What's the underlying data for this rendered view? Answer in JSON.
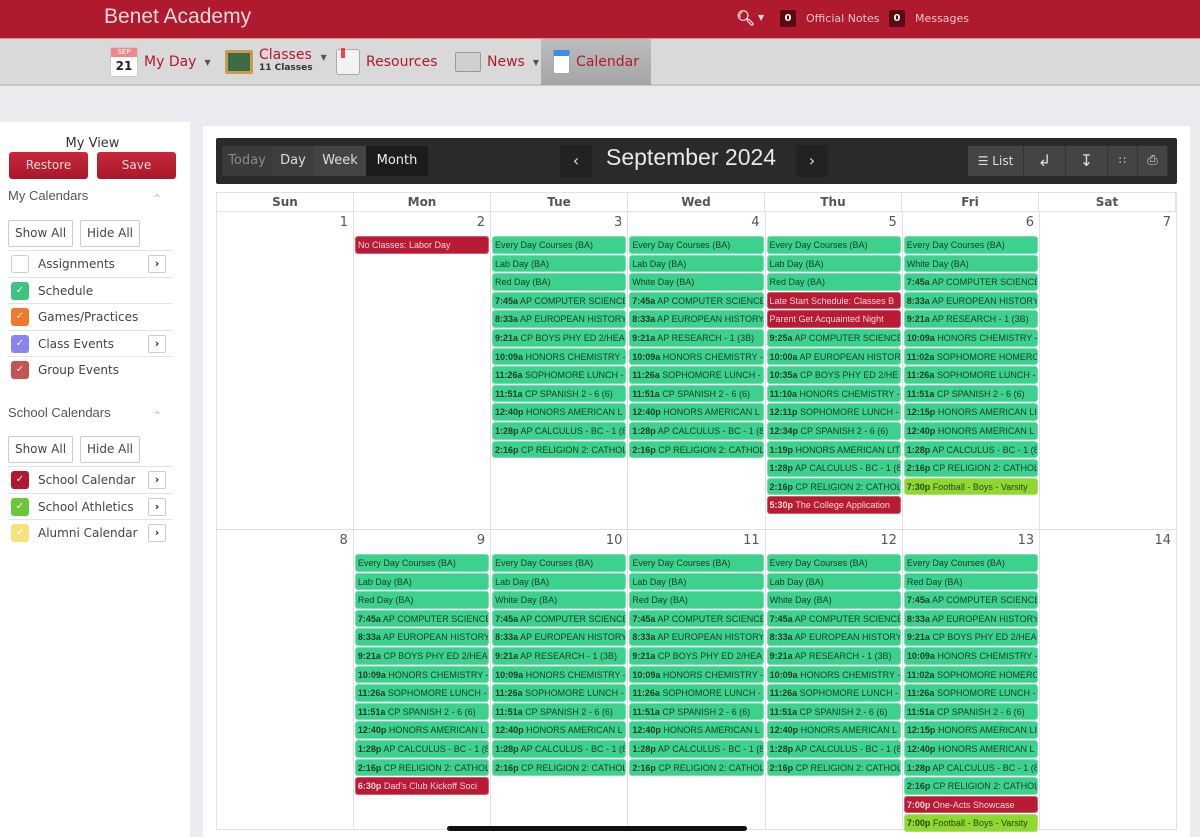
{
  "header": {
    "brand": "Benet Academy",
    "search_icon": "search-icon",
    "official_notes_count": "0",
    "official_notes_label": "Official Notes",
    "messages_count": "0",
    "messages_label": "Messages"
  },
  "nav": {
    "myday_month": "SEP",
    "myday_day": "21",
    "myday_label": "My Day",
    "classes_label": "Classes",
    "classes_sub": "11 Classes",
    "resources_label": "Resources",
    "news_label": "News",
    "calendar_label": "Calendar"
  },
  "sidebar": {
    "my_view": "My View",
    "restore": "Restore",
    "save": "Save",
    "my_calendars_title": "My Calendars",
    "school_calendars_title": "School Calendars",
    "show_all": "Show All",
    "hide_all": "Hide All",
    "my_calendars": [
      {
        "label": "Assignments",
        "checked": false,
        "color": "#ffffff",
        "has_arrow": true
      },
      {
        "label": "Schedule",
        "checked": true,
        "color": "#3dc47e",
        "has_arrow": false
      },
      {
        "label": "Games/Practices",
        "checked": true,
        "color": "#f07a2a",
        "has_arrow": false
      },
      {
        "label": "Class Events",
        "checked": true,
        "color": "#8b84f0",
        "has_arrow": true
      },
      {
        "label": "Group Events",
        "checked": true,
        "color": "#c5544e",
        "has_arrow": false
      }
    ],
    "school_calendars": [
      {
        "label": "School Calendar",
        "checked": true,
        "color": "#b01a2e",
        "has_arrow": true
      },
      {
        "label": "School Athletics",
        "checked": true,
        "color": "#6cc63a",
        "has_arrow": true
      },
      {
        "label": "Alumni Calendar",
        "checked": true,
        "color": "#f5e27a",
        "has_arrow": true
      }
    ]
  },
  "toolbar": {
    "today": "Today",
    "day": "Day",
    "week": "Week",
    "month": "Month",
    "prev": "‹",
    "next": "›",
    "title": "September 2024",
    "list": "List"
  },
  "day_headers": [
    "Sun",
    "Mon",
    "Tue",
    "Wed",
    "Thu",
    "Fri",
    "Sat"
  ],
  "weeks": [
    [
      {
        "day": "1",
        "events": []
      },
      {
        "day": "2",
        "events": [
          {
            "t": "",
            "text": "No Classes: Labor Day",
            "c": "red"
          }
        ]
      },
      {
        "day": "3",
        "events": [
          {
            "t": "",
            "text": "Every Day Courses (BA)",
            "c": "green"
          },
          {
            "t": "",
            "text": "Lab Day (BA)",
            "c": "green"
          },
          {
            "t": "",
            "text": "Red Day (BA)",
            "c": "green"
          },
          {
            "t": "7:45a",
            "text": "AP COMPUTER SCIENCE",
            "c": "green"
          },
          {
            "t": "8:33a",
            "text": "AP EUROPEAN HISTORY",
            "c": "green"
          },
          {
            "t": "9:21a",
            "text": "CP BOYS PHY ED 2/HEA",
            "c": "green"
          },
          {
            "t": "10:09a",
            "text": "HONORS CHEMISTRY -",
            "c": "green"
          },
          {
            "t": "11:26a",
            "text": "SOPHOMORE LUNCH -",
            "c": "green"
          },
          {
            "t": "11:51a",
            "text": "CP SPANISH 2 - 6 (6)",
            "c": "green"
          },
          {
            "t": "12:40p",
            "text": "HONORS AMERICAN L",
            "c": "green"
          },
          {
            "t": "1:28p",
            "text": "AP CALCULUS - BC - 1 (8",
            "c": "green"
          },
          {
            "t": "2:16p",
            "text": "CP RELIGION 2: CATHOL",
            "c": "green"
          }
        ]
      },
      {
        "day": "4",
        "events": [
          {
            "t": "",
            "text": "Every Day Courses (BA)",
            "c": "green"
          },
          {
            "t": "",
            "text": "Lab Day (BA)",
            "c": "green"
          },
          {
            "t": "",
            "text": "White Day (BA)",
            "c": "green"
          },
          {
            "t": "7:45a",
            "text": "AP COMPUTER SCIENCE",
            "c": "green"
          },
          {
            "t": "8:33a",
            "text": "AP EUROPEAN HISTORY",
            "c": "green"
          },
          {
            "t": "9:21a",
            "text": "AP RESEARCH - 1 (3B)",
            "c": "green"
          },
          {
            "t": "10:09a",
            "text": "HONORS CHEMISTRY -",
            "c": "green"
          },
          {
            "t": "11:26a",
            "text": "SOPHOMORE LUNCH -",
            "c": "green"
          },
          {
            "t": "11:51a",
            "text": "CP SPANISH 2 - 6 (6)",
            "c": "green"
          },
          {
            "t": "12:40p",
            "text": "HONORS AMERICAN L",
            "c": "green"
          },
          {
            "t": "1:28p",
            "text": "AP CALCULUS - BC - 1 (8",
            "c": "green"
          },
          {
            "t": "2:16p",
            "text": "CP RELIGION 2: CATHOL",
            "c": "green"
          }
        ]
      },
      {
        "day": "5",
        "events": [
          {
            "t": "",
            "text": "Every Day Courses (BA)",
            "c": "green"
          },
          {
            "t": "",
            "text": "Lab Day (BA)",
            "c": "green"
          },
          {
            "t": "",
            "text": "Red Day (BA)",
            "c": "green"
          },
          {
            "t": "",
            "text": "Late Start Schedule: Classes B",
            "c": "red"
          },
          {
            "t": "",
            "text": "Parent Get Acquainted Night",
            "c": "red"
          },
          {
            "t": "9:25a",
            "text": "AP COMPUTER SCIENCE",
            "c": "green"
          },
          {
            "t": "10:00a",
            "text": "AP EUROPEAN HISTOR",
            "c": "green"
          },
          {
            "t": "10:35a",
            "text": "CP BOYS PHY ED 2/HE",
            "c": "green"
          },
          {
            "t": "11:10a",
            "text": "HONORS CHEMISTRY -",
            "c": "green"
          },
          {
            "t": "12:11p",
            "text": "SOPHOMORE LUNCH -",
            "c": "green"
          },
          {
            "t": "12:34p",
            "text": "CP SPANISH 2 - 6 (6)",
            "c": "green"
          },
          {
            "t": "1:19p",
            "text": "HONORS AMERICAN LIT",
            "c": "green"
          },
          {
            "t": "1:28p",
            "text": "AP CALCULUS - BC - 1 (8",
            "c": "green"
          },
          {
            "t": "2:16p",
            "text": "CP RELIGION 2: CATHOL",
            "c": "green"
          },
          {
            "t": "5:30p",
            "text": "The College Application",
            "c": "red"
          }
        ]
      },
      {
        "day": "6",
        "events": [
          {
            "t": "",
            "text": "Every Day Courses (BA)",
            "c": "green"
          },
          {
            "t": "",
            "text": "White Day (BA)",
            "c": "green"
          },
          {
            "t": "7:45a",
            "text": "AP COMPUTER SCIENCE",
            "c": "green"
          },
          {
            "t": "8:33a",
            "text": "AP EUROPEAN HISTORY",
            "c": "green"
          },
          {
            "t": "9:21a",
            "text": "AP RESEARCH - 1 (3B)",
            "c": "green"
          },
          {
            "t": "10:09a",
            "text": "HONORS CHEMISTRY -",
            "c": "green"
          },
          {
            "t": "11:02a",
            "text": "SOPHOMORE HOMERO",
            "c": "green"
          },
          {
            "t": "11:26a",
            "text": "SOPHOMORE LUNCH -",
            "c": "green"
          },
          {
            "t": "11:51a",
            "text": "CP SPANISH 2 - 6 (6)",
            "c": "green"
          },
          {
            "t": "12:15p",
            "text": "HONORS AMERICAN LI",
            "c": "green"
          },
          {
            "t": "12:40p",
            "text": "HONORS AMERICAN L",
            "c": "green"
          },
          {
            "t": "1:28p",
            "text": "AP CALCULUS - BC - 1 (8",
            "c": "green"
          },
          {
            "t": "2:16p",
            "text": "CP RELIGION 2: CATHOL",
            "c": "green"
          },
          {
            "t": "7:30p",
            "text": "Football - Boys - Varsity",
            "c": "lime"
          }
        ]
      },
      {
        "day": "7",
        "events": []
      }
    ],
    [
      {
        "day": "8",
        "events": []
      },
      {
        "day": "9",
        "events": [
          {
            "t": "",
            "text": "Every Day Courses (BA)",
            "c": "green"
          },
          {
            "t": "",
            "text": "Lab Day (BA)",
            "c": "green"
          },
          {
            "t": "",
            "text": "Red Day (BA)",
            "c": "green"
          },
          {
            "t": "7:45a",
            "text": "AP COMPUTER SCIENCE",
            "c": "green"
          },
          {
            "t": "8:33a",
            "text": "AP EUROPEAN HISTORY",
            "c": "green"
          },
          {
            "t": "9:21a",
            "text": "CP BOYS PHY ED 2/HEA",
            "c": "green"
          },
          {
            "t": "10:09a",
            "text": "HONORS CHEMISTRY -",
            "c": "green"
          },
          {
            "t": "11:26a",
            "text": "SOPHOMORE LUNCH -",
            "c": "green"
          },
          {
            "t": "11:51a",
            "text": "CP SPANISH 2 - 6 (6)",
            "c": "green"
          },
          {
            "t": "12:40p",
            "text": "HONORS AMERICAN L",
            "c": "green"
          },
          {
            "t": "1:28p",
            "text": "AP CALCULUS - BC - 1 (8",
            "c": "green"
          },
          {
            "t": "2:16p",
            "text": "CP RELIGION 2: CATHOL",
            "c": "green"
          },
          {
            "t": "6:30p",
            "text": "Dad's Club Kickoff Soci",
            "c": "red"
          }
        ]
      },
      {
        "day": "10",
        "events": [
          {
            "t": "",
            "text": "Every Day Courses (BA)",
            "c": "green"
          },
          {
            "t": "",
            "text": "Lab Day (BA)",
            "c": "green"
          },
          {
            "t": "",
            "text": "White Day (BA)",
            "c": "green"
          },
          {
            "t": "7:45a",
            "text": "AP COMPUTER SCIENCE",
            "c": "green"
          },
          {
            "t": "8:33a",
            "text": "AP EUROPEAN HISTORY",
            "c": "green"
          },
          {
            "t": "9:21a",
            "text": "AP RESEARCH - 1 (3B)",
            "c": "green"
          },
          {
            "t": "10:09a",
            "text": "HONORS CHEMISTRY -",
            "c": "green"
          },
          {
            "t": "11:26a",
            "text": "SOPHOMORE LUNCH -",
            "c": "green"
          },
          {
            "t": "11:51a",
            "text": "CP SPANISH 2 - 6 (6)",
            "c": "green"
          },
          {
            "t": "12:40p",
            "text": "HONORS AMERICAN L",
            "c": "green"
          },
          {
            "t": "1:28p",
            "text": "AP CALCULUS - BC - 1 (8",
            "c": "green"
          },
          {
            "t": "2:16p",
            "text": "CP RELIGION 2: CATHOL",
            "c": "green"
          }
        ]
      },
      {
        "day": "11",
        "events": [
          {
            "t": "",
            "text": "Every Day Courses (BA)",
            "c": "green"
          },
          {
            "t": "",
            "text": "Lab Day (BA)",
            "c": "green"
          },
          {
            "t": "",
            "text": "Red Day (BA)",
            "c": "green"
          },
          {
            "t": "7:45a",
            "text": "AP COMPUTER SCIENCE",
            "c": "green"
          },
          {
            "t": "8:33a",
            "text": "AP EUROPEAN HISTORY",
            "c": "green"
          },
          {
            "t": "9:21a",
            "text": "CP BOYS PHY ED 2/HEA",
            "c": "green"
          },
          {
            "t": "10:09a",
            "text": "HONORS CHEMISTRY -",
            "c": "green"
          },
          {
            "t": "11:26a",
            "text": "SOPHOMORE LUNCH -",
            "c": "green"
          },
          {
            "t": "11:51a",
            "text": "CP SPANISH 2 - 6 (6)",
            "c": "green"
          },
          {
            "t": "12:40p",
            "text": "HONORS AMERICAN L",
            "c": "green"
          },
          {
            "t": "1:28p",
            "text": "AP CALCULUS - BC - 1 (8",
            "c": "green"
          },
          {
            "t": "2:16p",
            "text": "CP RELIGION 2: CATHOL",
            "c": "green"
          }
        ]
      },
      {
        "day": "12",
        "events": [
          {
            "t": "",
            "text": "Every Day Courses (BA)",
            "c": "green"
          },
          {
            "t": "",
            "text": "Lab Day (BA)",
            "c": "green"
          },
          {
            "t": "",
            "text": "White Day (BA)",
            "c": "green"
          },
          {
            "t": "7:45a",
            "text": "AP COMPUTER SCIENCE",
            "c": "green"
          },
          {
            "t": "8:33a",
            "text": "AP EUROPEAN HISTORY",
            "c": "green"
          },
          {
            "t": "9:21a",
            "text": "AP RESEARCH - 1 (3B)",
            "c": "green"
          },
          {
            "t": "10:09a",
            "text": "HONORS CHEMISTRY -",
            "c": "green"
          },
          {
            "t": "11:26a",
            "text": "SOPHOMORE LUNCH -",
            "c": "green"
          },
          {
            "t": "11:51a",
            "text": "CP SPANISH 2 - 6 (6)",
            "c": "green"
          },
          {
            "t": "12:40p",
            "text": "HONORS AMERICAN L",
            "c": "green"
          },
          {
            "t": "1:28p",
            "text": "AP CALCULUS - BC - 1 (8",
            "c": "green"
          },
          {
            "t": "2:16p",
            "text": "CP RELIGION 2: CATHOL",
            "c": "green"
          }
        ]
      },
      {
        "day": "13",
        "events": [
          {
            "t": "",
            "text": "Every Day Courses (BA)",
            "c": "green"
          },
          {
            "t": "",
            "text": "Red Day (BA)",
            "c": "green"
          },
          {
            "t": "7:45a",
            "text": "AP COMPUTER SCIENCE",
            "c": "green"
          },
          {
            "t": "8:33a",
            "text": "AP EUROPEAN HISTORY",
            "c": "green"
          },
          {
            "t": "9:21a",
            "text": "CP BOYS PHY ED 2/HEA",
            "c": "green"
          },
          {
            "t": "10:09a",
            "text": "HONORS CHEMISTRY -",
            "c": "green"
          },
          {
            "t": "11:02a",
            "text": "SOPHOMORE HOMERO",
            "c": "green"
          },
          {
            "t": "11:26a",
            "text": "SOPHOMORE LUNCH -",
            "c": "green"
          },
          {
            "t": "11:51a",
            "text": "CP SPANISH 2 - 6 (6)",
            "c": "green"
          },
          {
            "t": "12:15p",
            "text": "HONORS AMERICAN LI",
            "c": "green"
          },
          {
            "t": "12:40p",
            "text": "HONORS AMERICAN L",
            "c": "green"
          },
          {
            "t": "1:28p",
            "text": "AP CALCULUS - BC - 1 (8",
            "c": "green"
          },
          {
            "t": "2:16p",
            "text": "CP RELIGION 2: CATHOL",
            "c": "green"
          },
          {
            "t": "7:00p",
            "text": "One-Acts Showcase",
            "c": "red"
          },
          {
            "t": "7:00p",
            "text": "Football - Boys - Varsity",
            "c": "lime"
          }
        ]
      },
      {
        "day": "14",
        "events": []
      }
    ]
  ]
}
